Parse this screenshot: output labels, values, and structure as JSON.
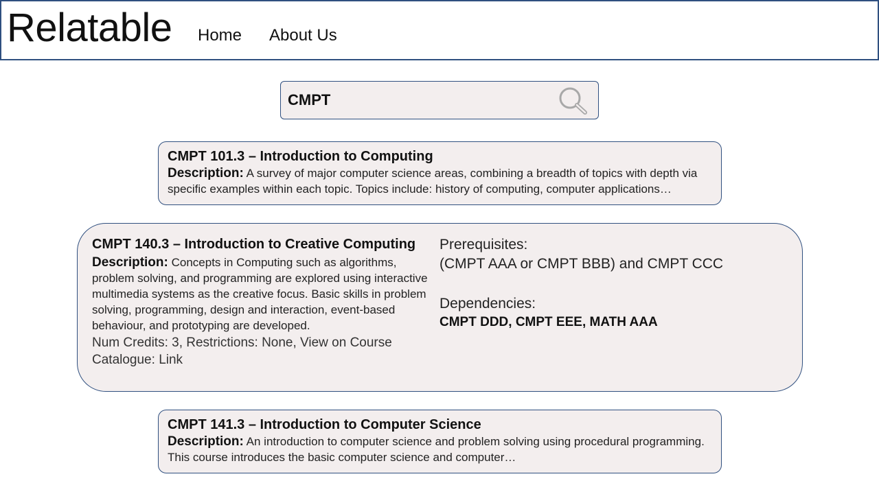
{
  "header": {
    "logo": "Relatable",
    "nav": {
      "home": "Home",
      "about": "About Us"
    }
  },
  "search": {
    "value": "CMPT",
    "icon": "magnifier-icon"
  },
  "courses": [
    {
      "title": "CMPT 101.3 – Introduction to Computing",
      "description_label": "Description:",
      "description": "A survey of major computer science areas, combining a breadth of topics with depth via specific examples within each topic. Topics include: history of computing, computer applications…"
    },
    {
      "title": "CMPT 140.3 – Introduction to Creative Computing",
      "description_label": "Description:",
      "description": "Concepts in Computing such as algorithms, problem solving, and programming are explored using interactive multimedia systems as the creative focus. Basic skills in problem solving, programming, design and interaction, event-based behaviour, and prototyping are developed.",
      "meta_prefix": "Num Credits: 3, Restrictions: None, View on Course Catalogue: ",
      "catalogue_link": "Link",
      "prerequisites_label": "Prerequisites:",
      "prerequisites": "(CMPT AAA or CMPT BBB) and CMPT CCC",
      "dependencies_label": "Dependencies:",
      "dependencies": "CMPT DDD, CMPT EEE, MATH AAA"
    },
    {
      "title": "CMPT 141.3 – Introduction to Computer Science",
      "description_label": "Description:",
      "description": "An introduction to computer science and problem solving using procedural programming. This course introduces the basic computer science and computer…"
    }
  ],
  "colors": {
    "border": "#2f4f7f",
    "card_bg": "#f3eeee"
  }
}
